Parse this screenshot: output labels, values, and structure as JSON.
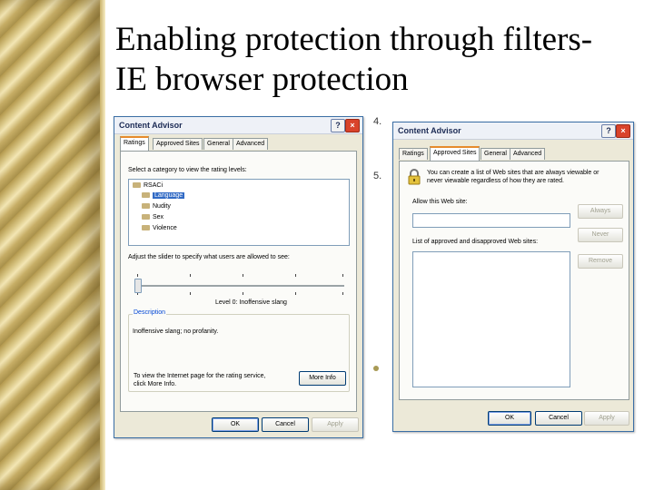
{
  "slide": {
    "title_line1": "Enabling protection through filters-",
    "title_line2": "IE browser protection",
    "bullet_4": "4.",
    "bullet_5": "5."
  },
  "colors": {
    "gold": "#c7ae66",
    "accent_tab": "#e68b2c",
    "link_blue": "#0046d5",
    "selection": "#316ac5"
  },
  "dialog1": {
    "title": "Content Advisor",
    "help_glyph": "?",
    "close_glyph": "×",
    "tabs": [
      "Ratings",
      "Approved Sites",
      "General",
      "Advanced"
    ],
    "select_label": "Select a category to view the rating levels:",
    "tree": [
      "RSACi",
      "Language",
      "Nudity",
      "Sex",
      "Violence"
    ],
    "slider_label": "Adjust the slider to specify what users are allowed to see:",
    "level_text": "Level 0: Inoffensive slang",
    "description_title": "Description",
    "description_text": "Inoffensive slang; no profanity.",
    "info_line1": "To view the Internet page for the rating service,",
    "info_line2": "click More Info.",
    "more_info": "More Info",
    "ok": "OK",
    "cancel": "Cancel",
    "apply": "Apply"
  },
  "dialog2": {
    "title": "Content Advisor",
    "help_glyph": "?",
    "close_glyph": "×",
    "tabs": [
      "Ratings",
      "Approved Sites",
      "General",
      "Advanced"
    ],
    "intro_line1": "You can create a list of Web sites that are always viewable or",
    "intro_line2": "never viewable regardless of how they are rated.",
    "allow_label": "Allow this Web site:",
    "allow_value": "",
    "always": "Always",
    "never": "Never",
    "list_label": "List of approved and disapproved Web sites:",
    "remove": "Remove",
    "ok": "OK",
    "cancel": "Cancel",
    "apply": "Apply"
  }
}
